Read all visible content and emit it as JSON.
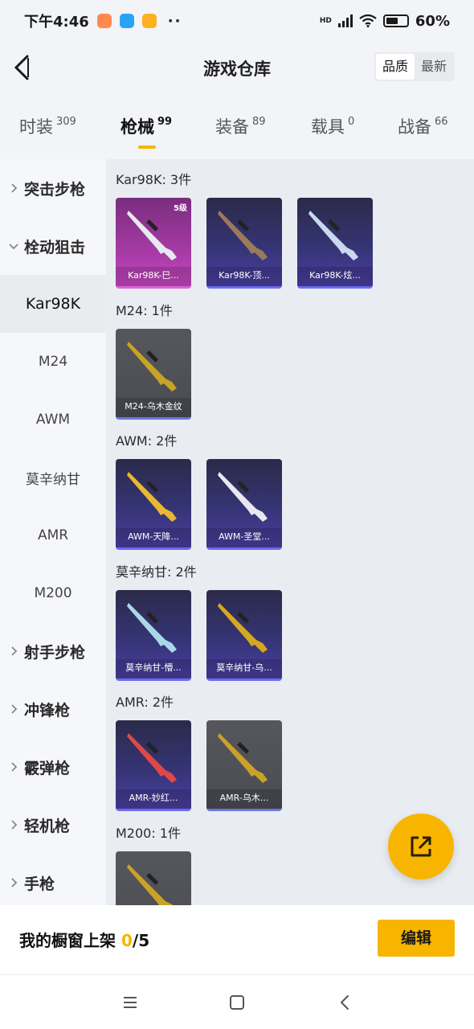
{
  "status_bar": {
    "time": "下午4:46",
    "hd": "HD",
    "battery": "60%",
    "app_icon_colors": [
      "#ff8a4c",
      "#29a3f5",
      "#ffb020"
    ]
  },
  "header": {
    "title": "游戏仓库",
    "sort_options": [
      "品质",
      "最新"
    ],
    "sort_selected": "品质"
  },
  "tabs": [
    {
      "label": "时装",
      "count": "309"
    },
    {
      "label": "枪械",
      "count": "99",
      "active": true
    },
    {
      "label": "装备",
      "count": "89"
    },
    {
      "label": "载具",
      "count": "0"
    },
    {
      "label": "战备",
      "count": "66"
    }
  ],
  "sidebar": [
    {
      "label": "突击步枪",
      "type": "cat"
    },
    {
      "label": "栓动狙击",
      "type": "cat",
      "expanded": true
    },
    {
      "label": "Kar98K",
      "type": "sub",
      "selected": true
    },
    {
      "label": "M24",
      "type": "sub"
    },
    {
      "label": "AWM",
      "type": "sub"
    },
    {
      "label": "莫辛纳甘",
      "type": "sub"
    },
    {
      "label": "AMR",
      "type": "sub"
    },
    {
      "label": "M200",
      "type": "sub"
    },
    {
      "label": "射手步枪",
      "type": "cat"
    },
    {
      "label": "冲锋枪",
      "type": "cat"
    },
    {
      "label": "霰弹枪",
      "type": "cat"
    },
    {
      "label": "轻机枪",
      "type": "cat"
    },
    {
      "label": "手枪",
      "type": "cat"
    }
  ],
  "groups": [
    {
      "title": "Kar98K: 3件",
      "items": [
        {
          "name": "Kar98K-巳...",
          "style": "pink",
          "level": "5级",
          "gun_color": "#e8e8f0"
        },
        {
          "name": "Kar98K-顶...",
          "style": "purple",
          "gun_color": "#9a7a5a"
        },
        {
          "name": "Kar98K-炫...",
          "style": "purple",
          "gun_color": "#c8d8f0"
        }
      ]
    },
    {
      "title": "M24: 1件",
      "items": [
        {
          "name": "M24-乌木金纹",
          "style": "gray",
          "gun_color": "#c9a227"
        }
      ]
    },
    {
      "title": "AWM: 2件",
      "items": [
        {
          "name": "AWM-天降...",
          "style": "purple",
          "gun_color": "#e8b830"
        },
        {
          "name": "AWM-圣堂...",
          "style": "purple",
          "gun_color": "#e8e8ee"
        }
      ]
    },
    {
      "title": "莫辛纳甘: 2件",
      "items": [
        {
          "name": "莫辛纳甘-懵...",
          "style": "purple",
          "gun_color": "#a8d8e8"
        },
        {
          "name": "莫辛纳甘-乌...",
          "style": "purple",
          "gun_color": "#d4a820"
        }
      ]
    },
    {
      "title": "AMR: 2件",
      "items": [
        {
          "name": "AMR-妙红...",
          "style": "purple",
          "gun_color": "#e04848"
        },
        {
          "name": "AMR-乌木...",
          "style": "gray",
          "gun_color": "#c9a227"
        }
      ]
    },
    {
      "title": "M200: 1件",
      "items": [
        {
          "name": "",
          "style": "gray",
          "gun_color": "#c9a227"
        }
      ]
    }
  ],
  "bottom": {
    "showcase_label": "我的橱窗上架",
    "showcase_current": "0",
    "showcase_total": "/5",
    "edit_label": "编辑"
  },
  "accent_color": "#f7b500"
}
